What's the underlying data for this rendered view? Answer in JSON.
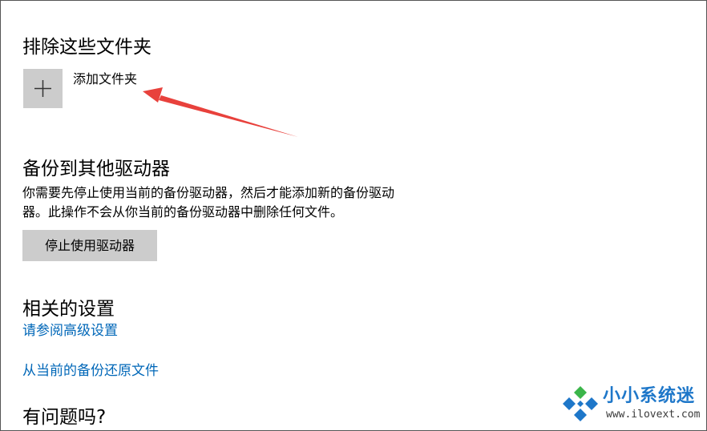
{
  "exclude_section": {
    "title": "排除这些文件夹",
    "add_folder_label": "添加文件夹"
  },
  "backup_drive_section": {
    "title": "备份到其他驱动器",
    "description_line1": "你需要先停止使用当前的备份驱动器，然后才能添加新的备份驱动",
    "description_line2": "器。此操作不会从你当前的备份驱动器中删除任何文件。",
    "stop_button_label": "停止使用驱动器"
  },
  "related_settings": {
    "title": "相关的设置",
    "links": [
      "请参阅高级设置",
      "从当前的备份还原文件"
    ]
  },
  "help_section": {
    "title": "有问题吗?"
  },
  "watermark": {
    "title": "小小系统迷",
    "url": "www.ilovext.com"
  },
  "colors": {
    "link": "#0067b8",
    "button_bg": "#cccccc",
    "arrow": "#e8413c",
    "watermark_blue": "#1e77c9",
    "watermark_green": "#3bb54a"
  },
  "icons": {
    "add": "plus-icon",
    "annotation": "red-arrow",
    "logo": "diamond-logo-icon"
  }
}
